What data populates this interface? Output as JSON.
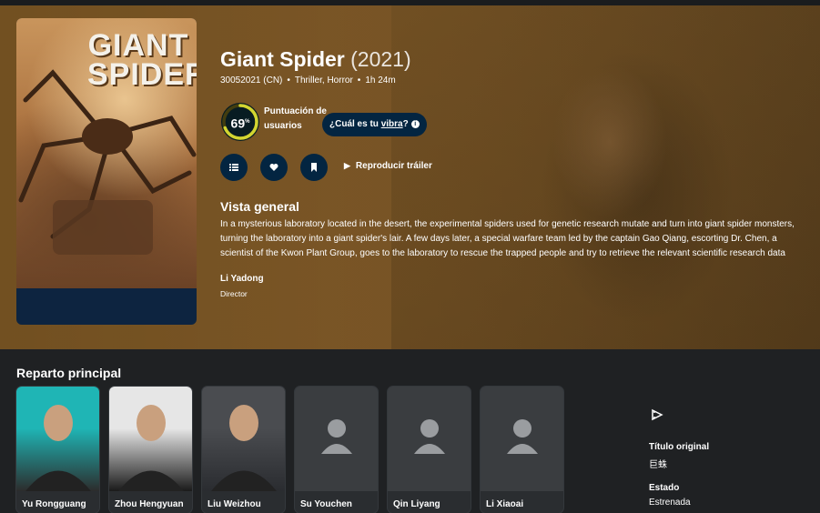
{
  "movie": {
    "title": "Giant Spider",
    "year": "(2021)",
    "release": "30052021 (CN)",
    "genres": "Thriller, Horror",
    "runtime": "1h 24m",
    "poster_title": "GIANT SPIDER"
  },
  "score": {
    "value": "69",
    "percent_symbol": "%",
    "fraction": 0.69,
    "label": "Puntuación de usuarios",
    "ring_color": "#d2d531",
    "track_color": "#423d0f"
  },
  "vibe": {
    "prefix": "¿Cuál es tu ",
    "link": "vibra",
    "suffix": "?"
  },
  "actions": {
    "list_icon": "list-icon",
    "favorite_icon": "heart-icon",
    "watchlist_icon": "bookmark-icon",
    "trailer_label": "Reproducir tráiler"
  },
  "overview": {
    "heading": "Vista general",
    "text": "In a mysterious laboratory located in the desert, the experimental spiders used for genetic research mutate and turn into giant spider monsters, turning the laboratory into a giant spider's lair. A few days later, a special warfare team led by the captain Gao Qiang, escorting Dr. Chen, a scientist of the Kwon Plant Group, goes to the laboratory to rescue the trapped people and try to retrieve the relevant scientific research data"
  },
  "crew": {
    "name": "Li Yadong",
    "role": "Director"
  },
  "cast": {
    "heading": "Reparto principal",
    "members": [
      {
        "name": "Yu Rongguang",
        "photo": true
      },
      {
        "name": "Zhou Hengyuan",
        "photo": true
      },
      {
        "name": "Liu Weizhou",
        "photo": true
      },
      {
        "name": "Su Youchen",
        "photo": false
      },
      {
        "name": "Qin Liyang",
        "photo": false
      },
      {
        "name": "Li Xiaoai",
        "photo": false
      }
    ]
  },
  "facts_side": {
    "icon": "justwatch-play-icon",
    "original_title_label": "Título original",
    "original_title": "巨蛛",
    "status_label": "Estado",
    "status": "Estrenada"
  },
  "colors": {
    "dark_blue": "#032541",
    "background": "#1f2123"
  }
}
